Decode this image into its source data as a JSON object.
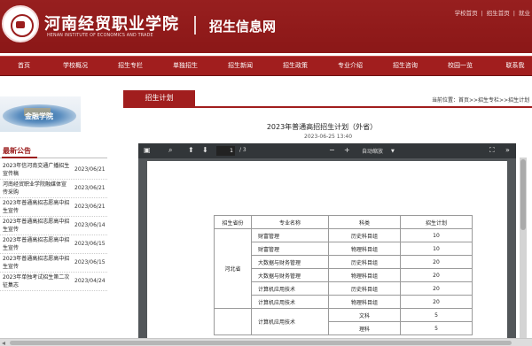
{
  "header": {
    "site_name": "河南经贸职业学院",
    "site_name_en": "HENAN INSTITUTE OF ECONOMICS AND TRADE",
    "subtitle": "招生信息网",
    "top_links": [
      "学校首页",
      "招生首页",
      "就业"
    ],
    "separator": "|"
  },
  "nav": [
    "首页",
    "学校概况",
    "招生专栏",
    "单独招生",
    "招生新闻",
    "招生政策",
    "专业介绍",
    "招生咨询",
    "校园一览",
    "联系我"
  ],
  "banner": {
    "text": "金融学院"
  },
  "news": {
    "title": "最新公告",
    "items": [
      {
        "title": "2023年信河南交通广播招生宣传稿",
        "date": "2023/06/21"
      },
      {
        "title": "河南经贸职业学院融媒体宣传采购",
        "date": "2023/06/21"
      },
      {
        "title": "2023年普通高招志愿高中招生宣传",
        "date": "2023/06/21"
      },
      {
        "title": "2023年普通高招志愿高中招生宣传",
        "date": "2023/06/14"
      },
      {
        "title": "2023年普通高招志愿高中招生宣传",
        "date": "2023/06/15"
      },
      {
        "title": "2023年普通高招志愿高中招生宣传",
        "date": "2023/06/15"
      },
      {
        "title": "2023年单独考试招生第二次征集志",
        "date": "2023/04/24"
      }
    ]
  },
  "content": {
    "tab": "招生计划",
    "breadcrumb": "当前位置：首页>>招生专栏>>招生计划",
    "title": "2023年普通高招招生计划（外省）",
    "date": "2023-06-25 13:40"
  },
  "pdf": {
    "page_current": "1",
    "page_total": "/ 3",
    "zoom": "自动缩放"
  },
  "table": {
    "headers": [
      "招生省份",
      "专业名称",
      "科类",
      "招生计划"
    ],
    "province": "河北省",
    "rows": [
      {
        "major": "财富管理",
        "subject": "历史科目组",
        "plan": "10"
      },
      {
        "major": "财富管理",
        "subject": "物理科目组",
        "plan": "10"
      },
      {
        "major": "大数据与财务管理",
        "subject": "历史科目组",
        "plan": "20"
      },
      {
        "major": "大数据与财务管理",
        "subject": "物理科目组",
        "plan": "20"
      },
      {
        "major": "计算机应用技术",
        "subject": "历史科目组",
        "plan": "20"
      },
      {
        "major": "计算机应用技术",
        "subject": "物理科目组",
        "plan": "20"
      },
      {
        "major": "计算机应用技术",
        "subject": "文科",
        "plan": "5"
      },
      {
        "major": "",
        "subject": "理科",
        "plan": "5"
      }
    ]
  }
}
